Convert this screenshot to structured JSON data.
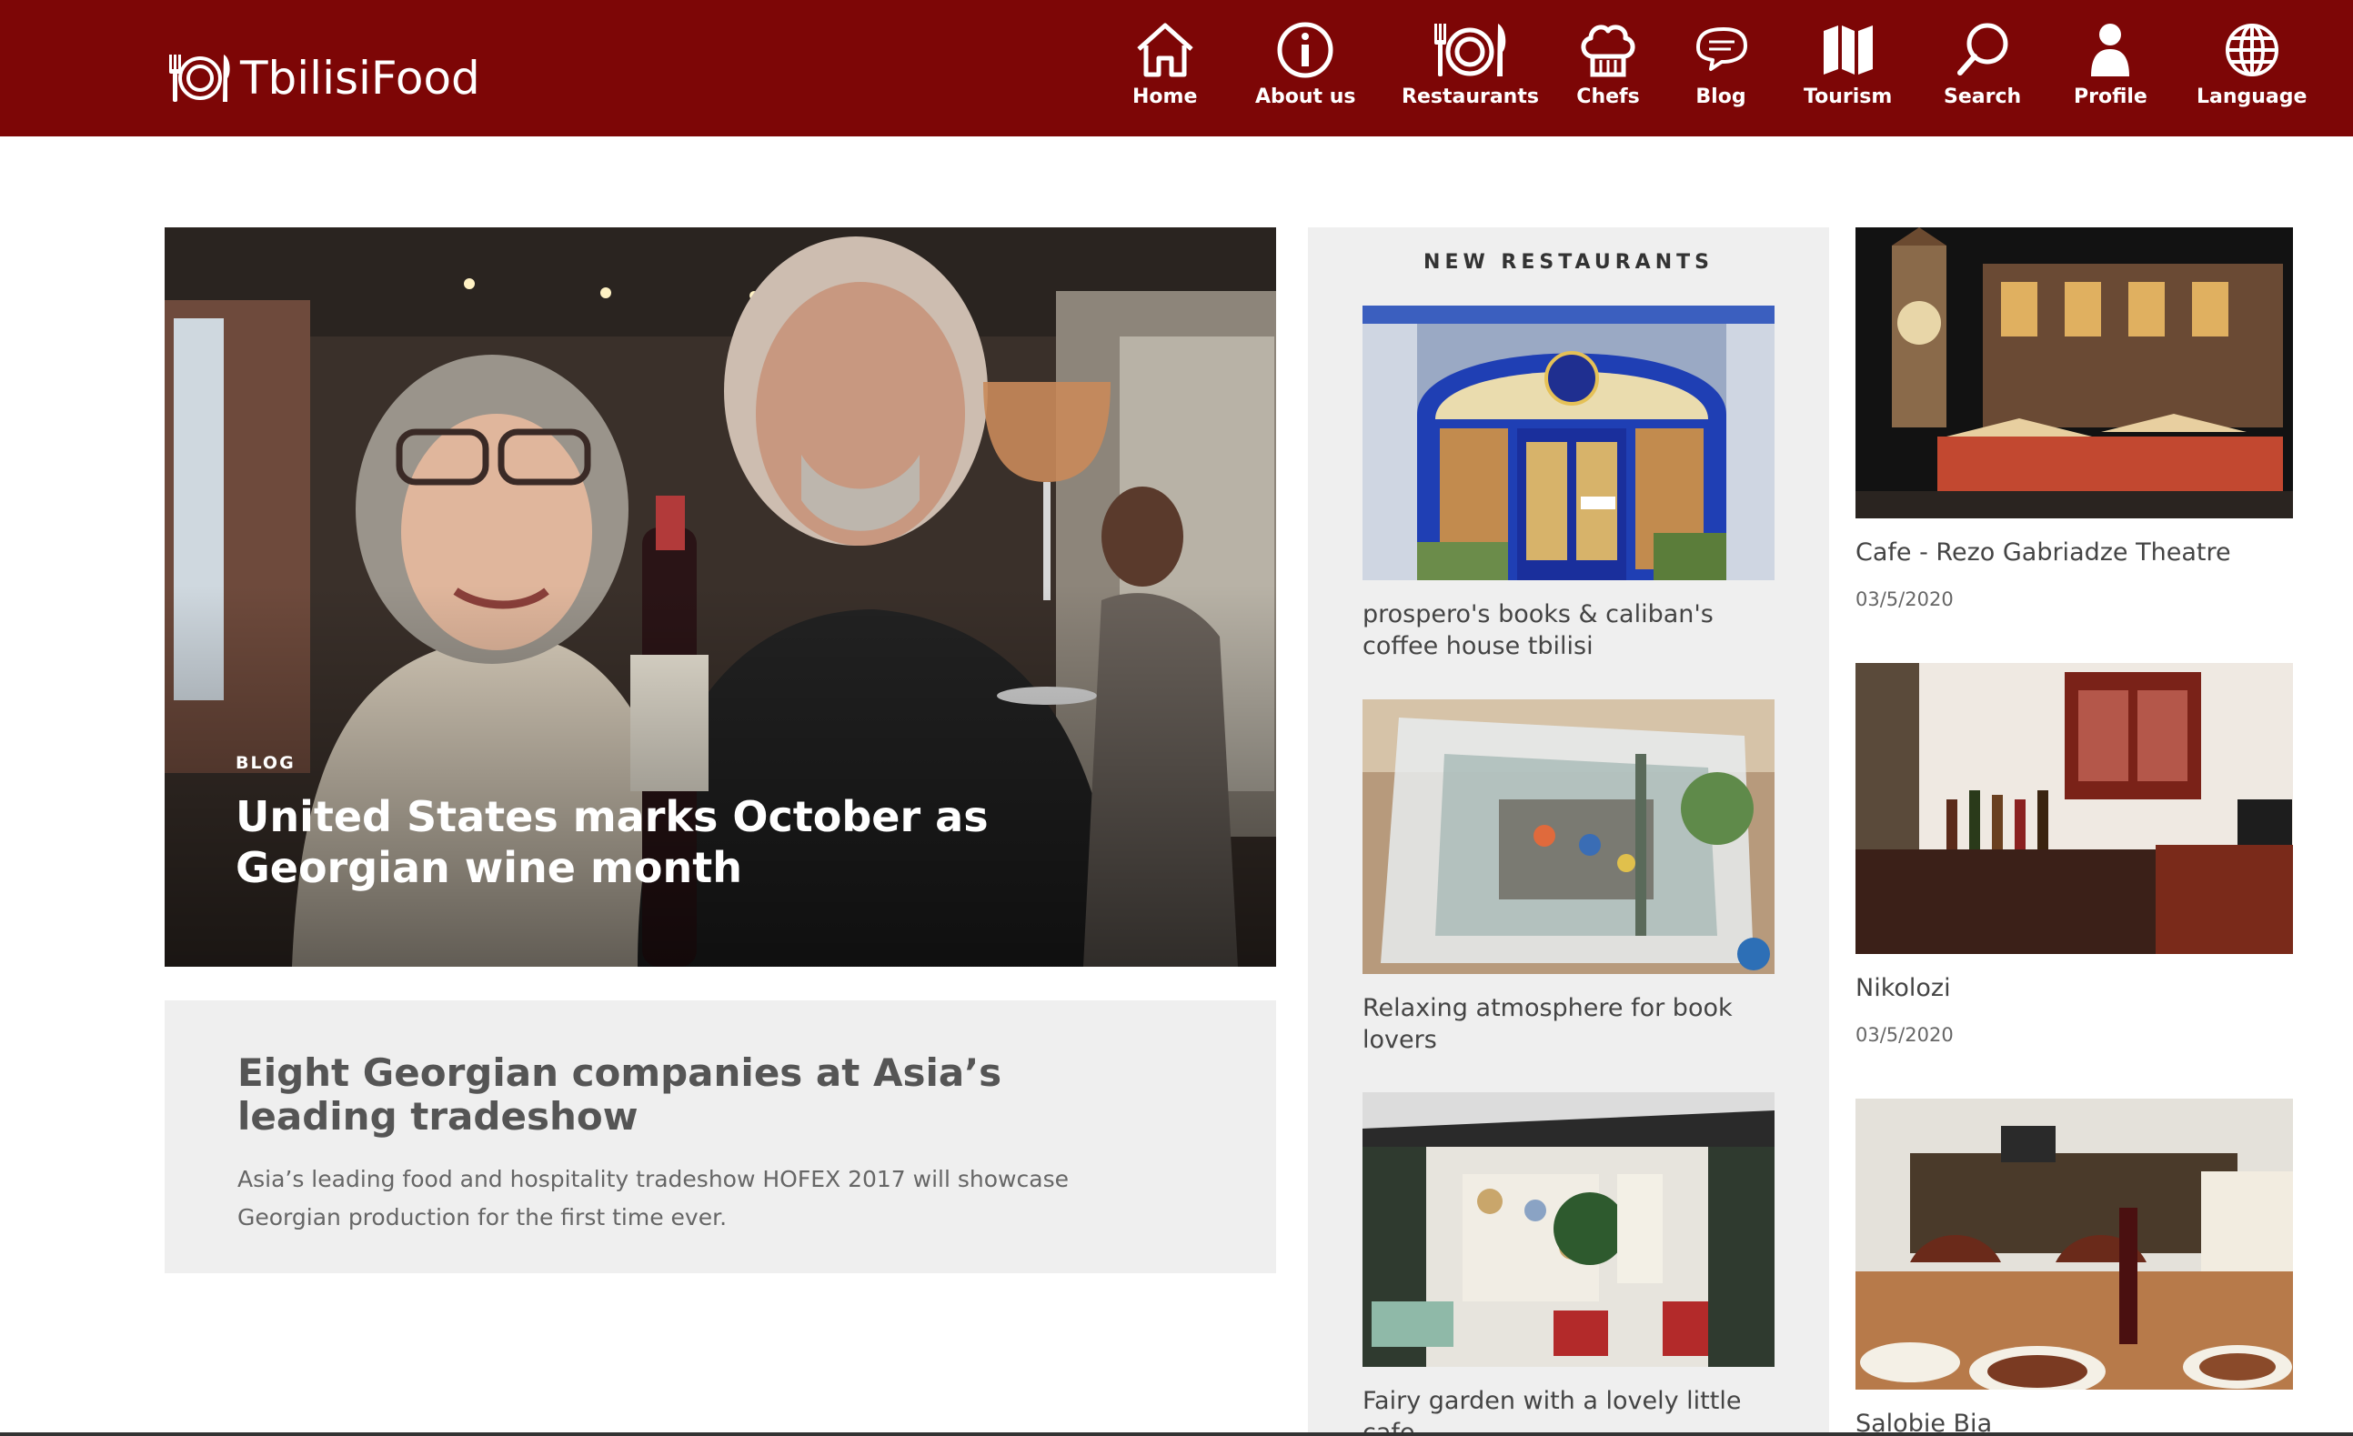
{
  "brand": {
    "name": "TbilisiFood",
    "color": "#7d0606"
  },
  "nav": [
    {
      "key": "home",
      "label": "Home",
      "icon": "home-icon"
    },
    {
      "key": "about",
      "label": "About us",
      "icon": "info-icon"
    },
    {
      "key": "restaurants",
      "label": "Restaurants",
      "icon": "plate-cutlery-icon"
    },
    {
      "key": "chefs",
      "label": "Chefs",
      "icon": "chef-hat-icon"
    },
    {
      "key": "blog",
      "label": "Blog",
      "icon": "chat-bubbles-icon"
    },
    {
      "key": "tourism",
      "label": "Tourism",
      "icon": "map-icon"
    },
    {
      "key": "search",
      "label": "Search",
      "icon": "search-icon"
    },
    {
      "key": "profile",
      "label": "Profile",
      "icon": "user-icon"
    },
    {
      "key": "language",
      "label": "Language",
      "icon": "globe-icon"
    }
  ],
  "hero": {
    "category": "BLOG",
    "title": "United States marks October as Georgian wine month"
  },
  "article": {
    "title": "Eight Georgian companies at Asia’s leading tradeshow",
    "excerpt": "Asia’s leading food and hospitality tradeshow HOFEX 2017 will showcase Georgian production for the first time ever."
  },
  "new_restaurants": {
    "heading": "NEW RESTAURANTS",
    "items": [
      {
        "name": "prospero's books & caliban's coffee house tbilisi"
      },
      {
        "name": "Relaxing atmosphere for book lovers"
      },
      {
        "name": "Fairy garden with a lovely little cafe"
      }
    ]
  },
  "featured": [
    {
      "name": "Cafe - Rezo Gabriadze Theatre",
      "date": "03/5/2020"
    },
    {
      "name": "Nikolozi",
      "date": "03/5/2020"
    },
    {
      "name": "Salobie Bia",
      "date": ""
    }
  ]
}
